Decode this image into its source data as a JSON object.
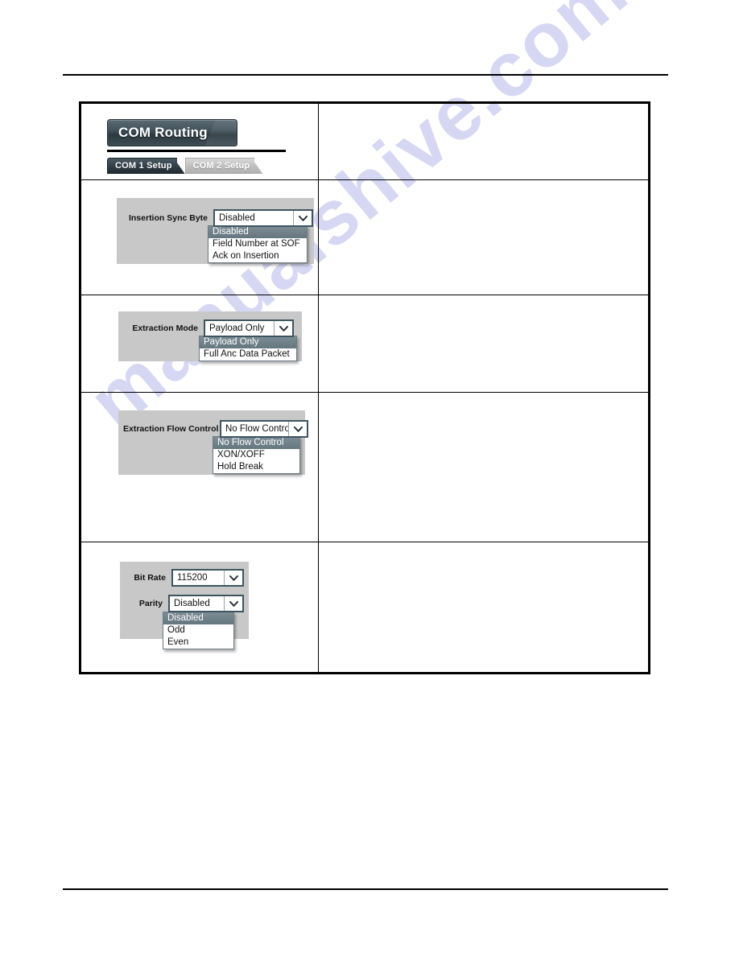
{
  "page": {
    "watermark": "manualshive.com"
  },
  "panel": {
    "title": "COM Routing",
    "tabs": [
      {
        "label": "COM 1 Setup",
        "active": true
      },
      {
        "label": "COM 2 Setup",
        "active": false
      }
    ]
  },
  "rows": [
    {
      "name": "header-row",
      "controls": []
    },
    {
      "name": "insertion-sync-byte-row",
      "controls": [
        {
          "label": "Insertion Sync Byte",
          "value": "Disabled",
          "options": [
            "Disabled",
            "Field Number at SOF",
            "Ack on Insertion"
          ],
          "selected_index": 0
        }
      ]
    },
    {
      "name": "extraction-mode-row",
      "controls": [
        {
          "label": "Extraction Mode",
          "value": "Payload Only",
          "options": [
            "Payload Only",
            "Full Anc Data Packet"
          ],
          "selected_index": 0
        }
      ]
    },
    {
      "name": "extraction-flow-control-row",
      "controls": [
        {
          "label": "Extraction Flow Control",
          "value": "No Flow Control",
          "options": [
            "No Flow Control",
            "XON/XOFF",
            "Hold Break"
          ],
          "selected_index": 0
        }
      ]
    },
    {
      "name": "serial-parameters-row",
      "controls": [
        {
          "label": "Bit Rate",
          "value": "115200",
          "options": [],
          "selected_index": -1
        },
        {
          "label": "Parity",
          "value": "Disabled",
          "options": [
            "Disabled",
            "Odd",
            "Even"
          ],
          "selected_index": 0
        }
      ]
    }
  ],
  "colors": {
    "panel_bg": "#c8c8c8",
    "banner_dark": "#2c3940",
    "combo_border": "#3d5560",
    "highlight": "#64767f",
    "watermark": "#c9caf0"
  },
  "icons": {
    "dropdown": "chevron-down-icon"
  }
}
